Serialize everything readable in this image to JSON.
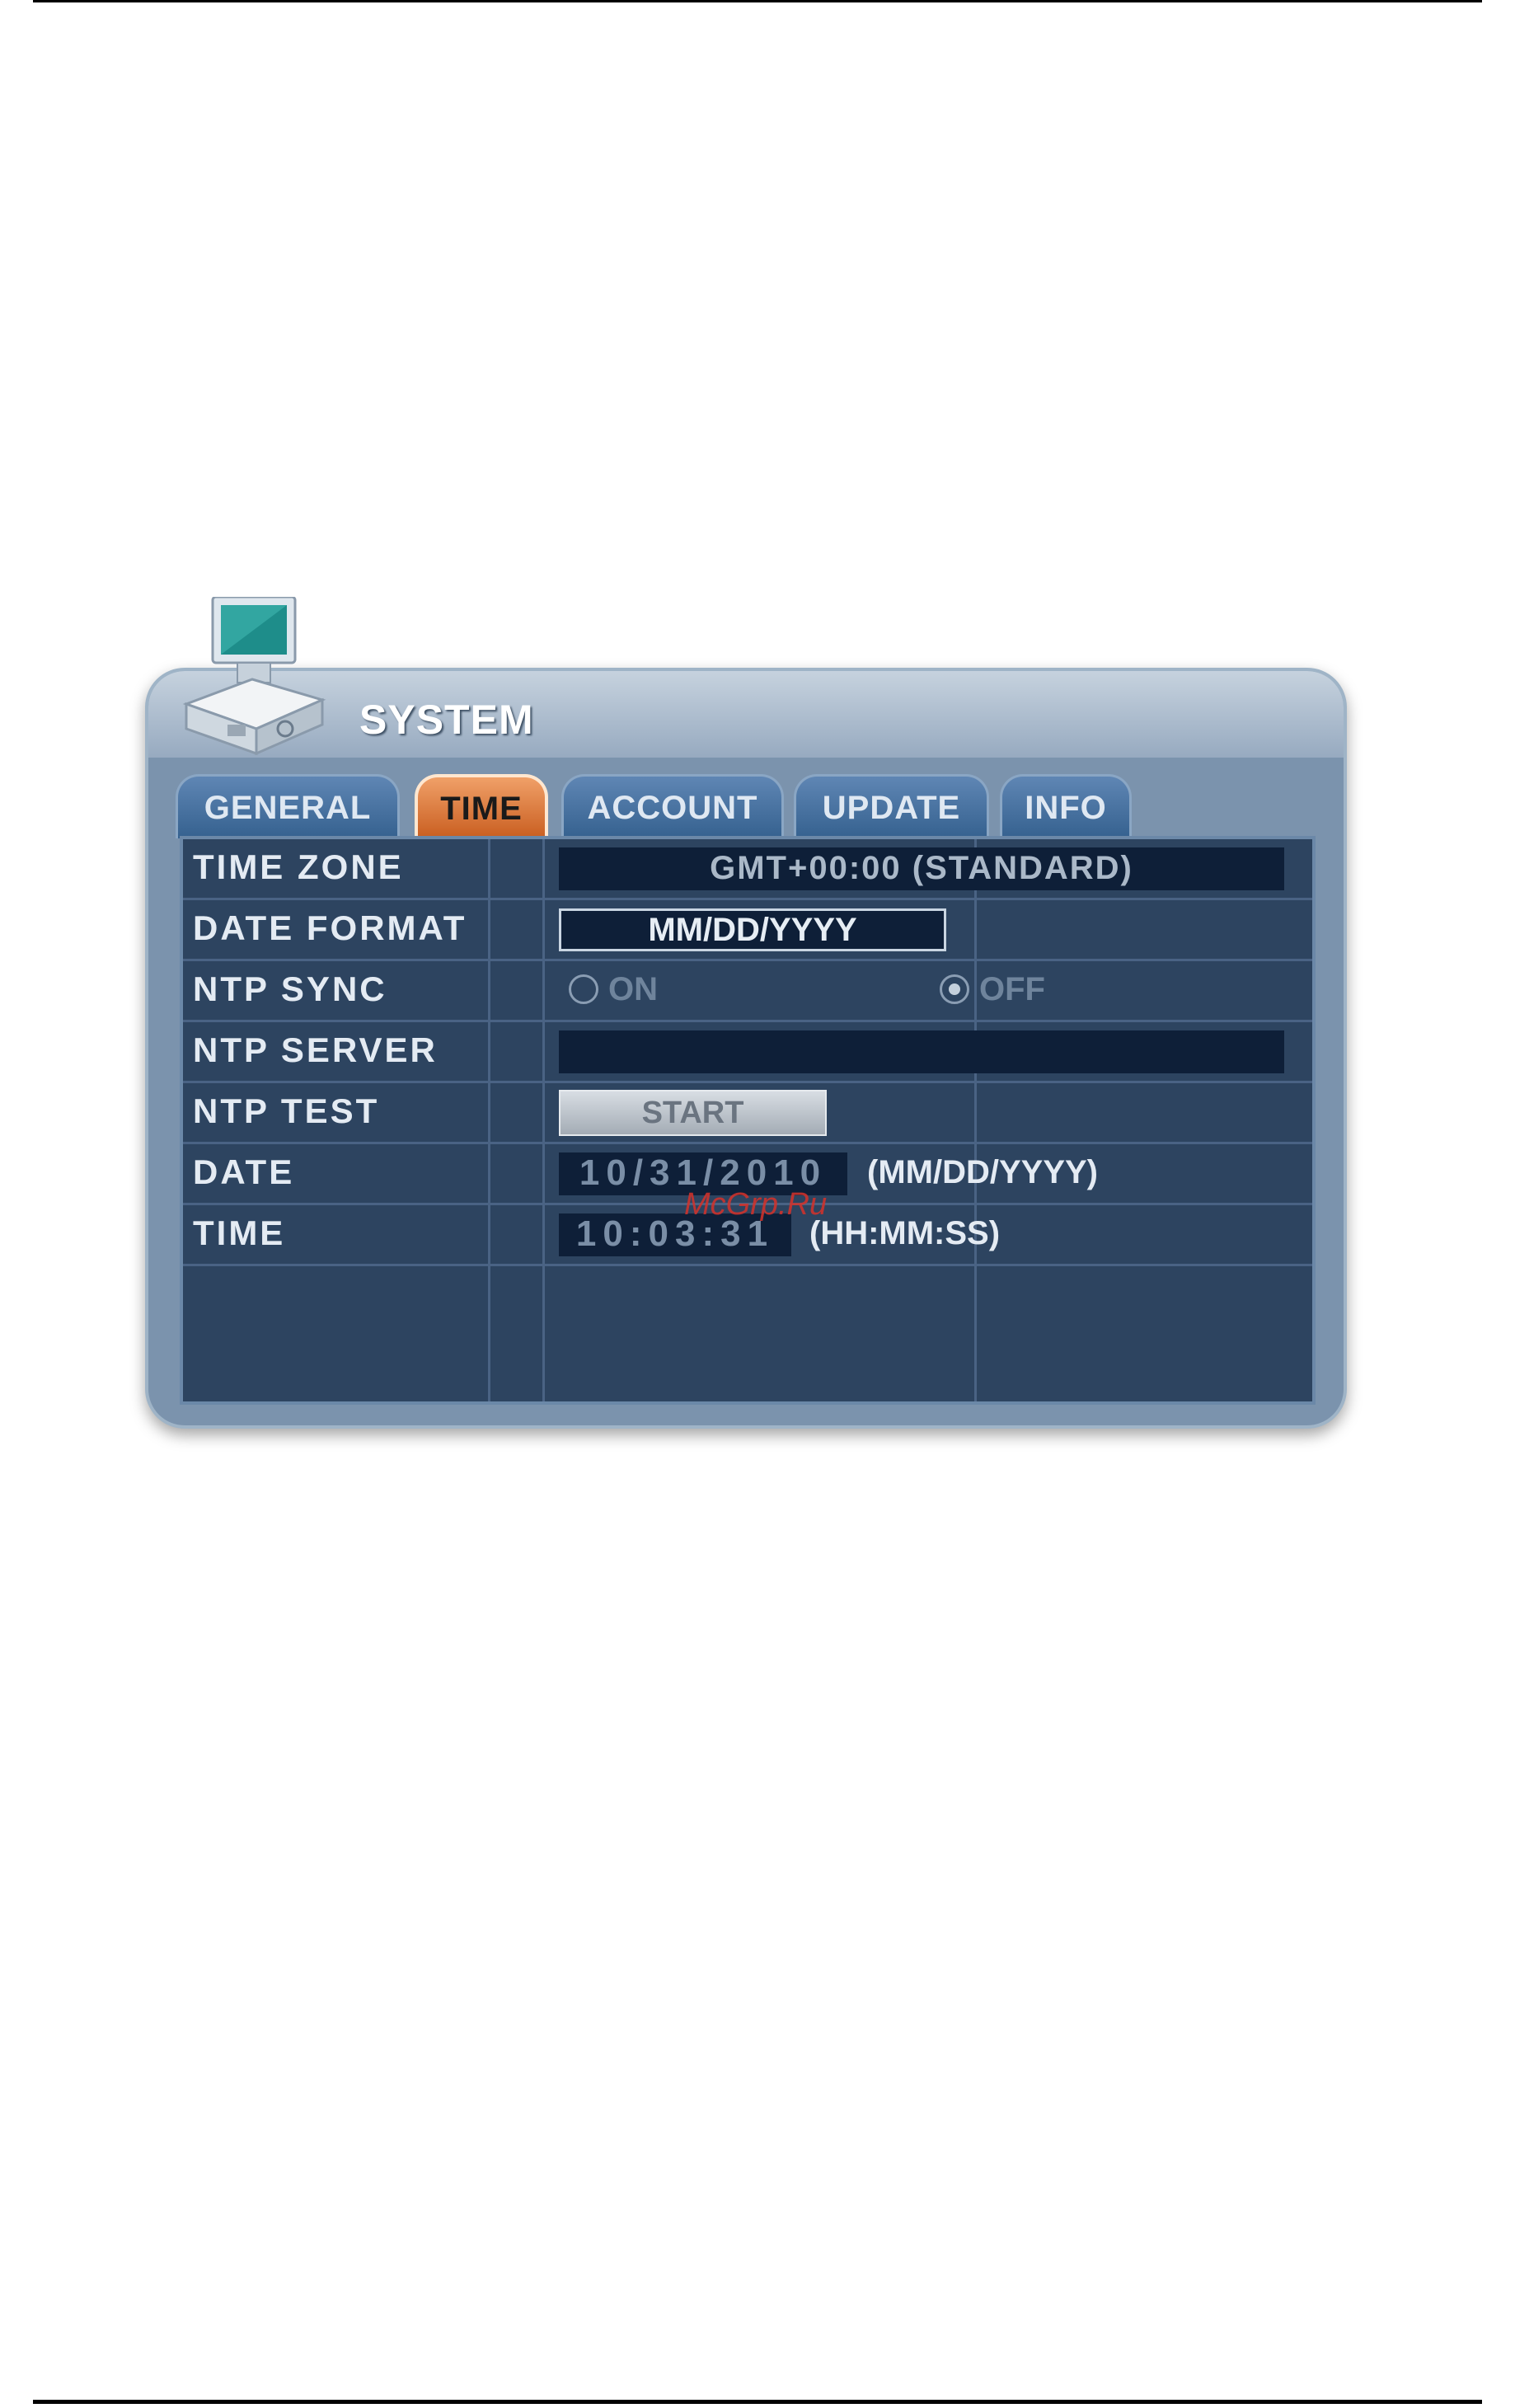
{
  "window": {
    "title": "SYSTEM"
  },
  "tabs": [
    {
      "label": "GENERAL",
      "active": false
    },
    {
      "label": "TIME",
      "active": true
    },
    {
      "label": "ACCOUNT",
      "active": false
    },
    {
      "label": "UPDATE",
      "active": false
    },
    {
      "label": "INFO",
      "active": false
    }
  ],
  "rows": {
    "time_zone": {
      "label": "TIME ZONE",
      "value": "GMT+00:00 (STANDARD)"
    },
    "date_format": {
      "label": "DATE FORMAT",
      "value": "MM/DD/YYYY"
    },
    "ntp_sync": {
      "label": "NTP SYNC",
      "on_label": "ON",
      "off_label": "OFF",
      "selected": "OFF"
    },
    "ntp_server": {
      "label": "NTP SERVER",
      "value": ""
    },
    "ntp_test": {
      "label": "NTP TEST",
      "button": "START"
    },
    "date": {
      "label": "DATE",
      "value": "10/31/2010",
      "format": "(MM/DD/YYYY)"
    },
    "time": {
      "label": "TIME",
      "value": "10:03:31",
      "format": "(HH:MM:SS)"
    }
  },
  "watermark": "McGrp.Ru",
  "colors": {
    "active_tab": "#d9773a",
    "panel": "#2d4460",
    "field": "#0e1f38"
  },
  "icons": {
    "logo": "dvr-computer-icon"
  }
}
